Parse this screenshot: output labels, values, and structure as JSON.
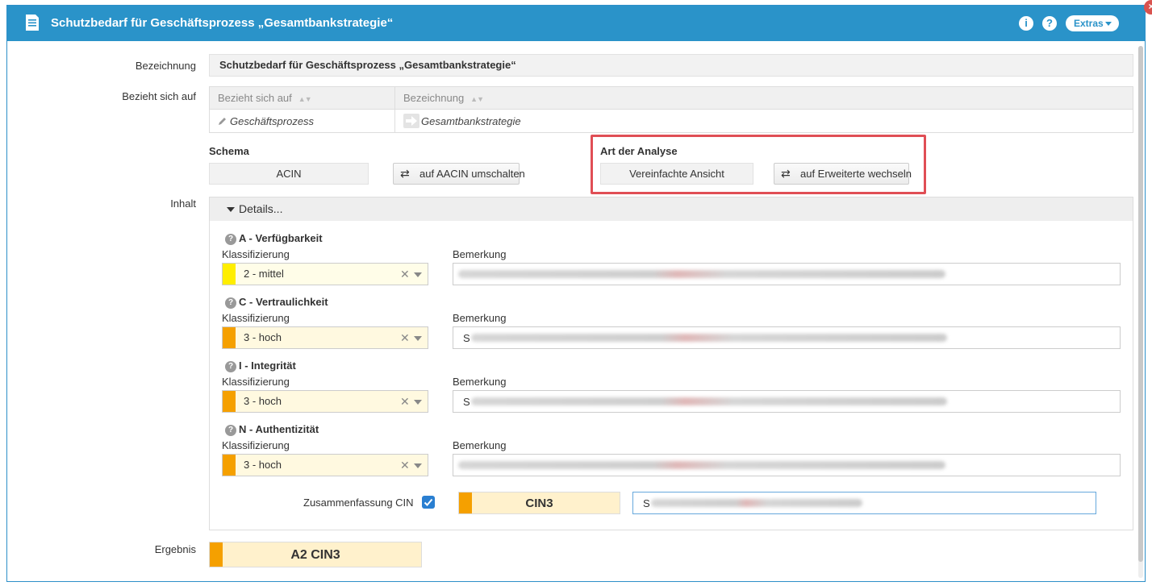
{
  "window": {
    "title": "Schutzbedarf für Geschäftsprozess „Gesamtbankstrategie“",
    "info_icon": "i",
    "help_icon": "?",
    "extras_label": "Extras",
    "close_icon": "×"
  },
  "form": {
    "bezeichnung_label": "Bezeichnung",
    "bezeichnung_value": "Schutzbedarf für Geschäftsprozess „Gesamtbankstrategie“",
    "bezieht_label": "Bezieht sich auf",
    "grid": {
      "headers": [
        "Bezieht sich auf",
        "Bezeichnung"
      ],
      "row": [
        "Geschäftsprozess",
        "Gesamtbankstrategie"
      ]
    },
    "schema_label": "Schema",
    "schema_value": "ACIN",
    "schema_switch_button": "auf AACIN umschalten",
    "analyse_label": "Art der Analyse",
    "analyse_value": "Vereinfachte Ansicht",
    "analyse_switch_button": "auf Erweiterte wechseln",
    "inhalt_label": "Inhalt",
    "details_title": "Details...",
    "classif_label": "Klassifizierung",
    "remark_label": "Bemerkung",
    "sections": [
      {
        "title": "A - Verfügbarkeit",
        "value": "2 - mittel",
        "color": "#ffee00",
        "remark_prefix": ""
      },
      {
        "title": "C - Vertraulichkeit",
        "value": "3 - hoch",
        "color": "#f5a000",
        "remark_prefix": "S"
      },
      {
        "title": "I - Integrität",
        "value": "3 - hoch",
        "color": "#f5a000",
        "remark_prefix": "S"
      },
      {
        "title": "N - Authentizität",
        "value": "3 - hoch",
        "color": "#f5a000",
        "remark_prefix": ""
      }
    ],
    "summary_label": "Zusammenfassung CIN",
    "summary_checked": true,
    "summary_value": "CIN3",
    "summary_remark_prefix": "S",
    "ergebnis_label": "Ergebnis",
    "ergebnis_value": "A2 CIN3"
  },
  "colors": {
    "accent": "#2a93c9",
    "highlight": "#e04e55",
    "high": "#f5a000",
    "medium": "#ffee00"
  }
}
